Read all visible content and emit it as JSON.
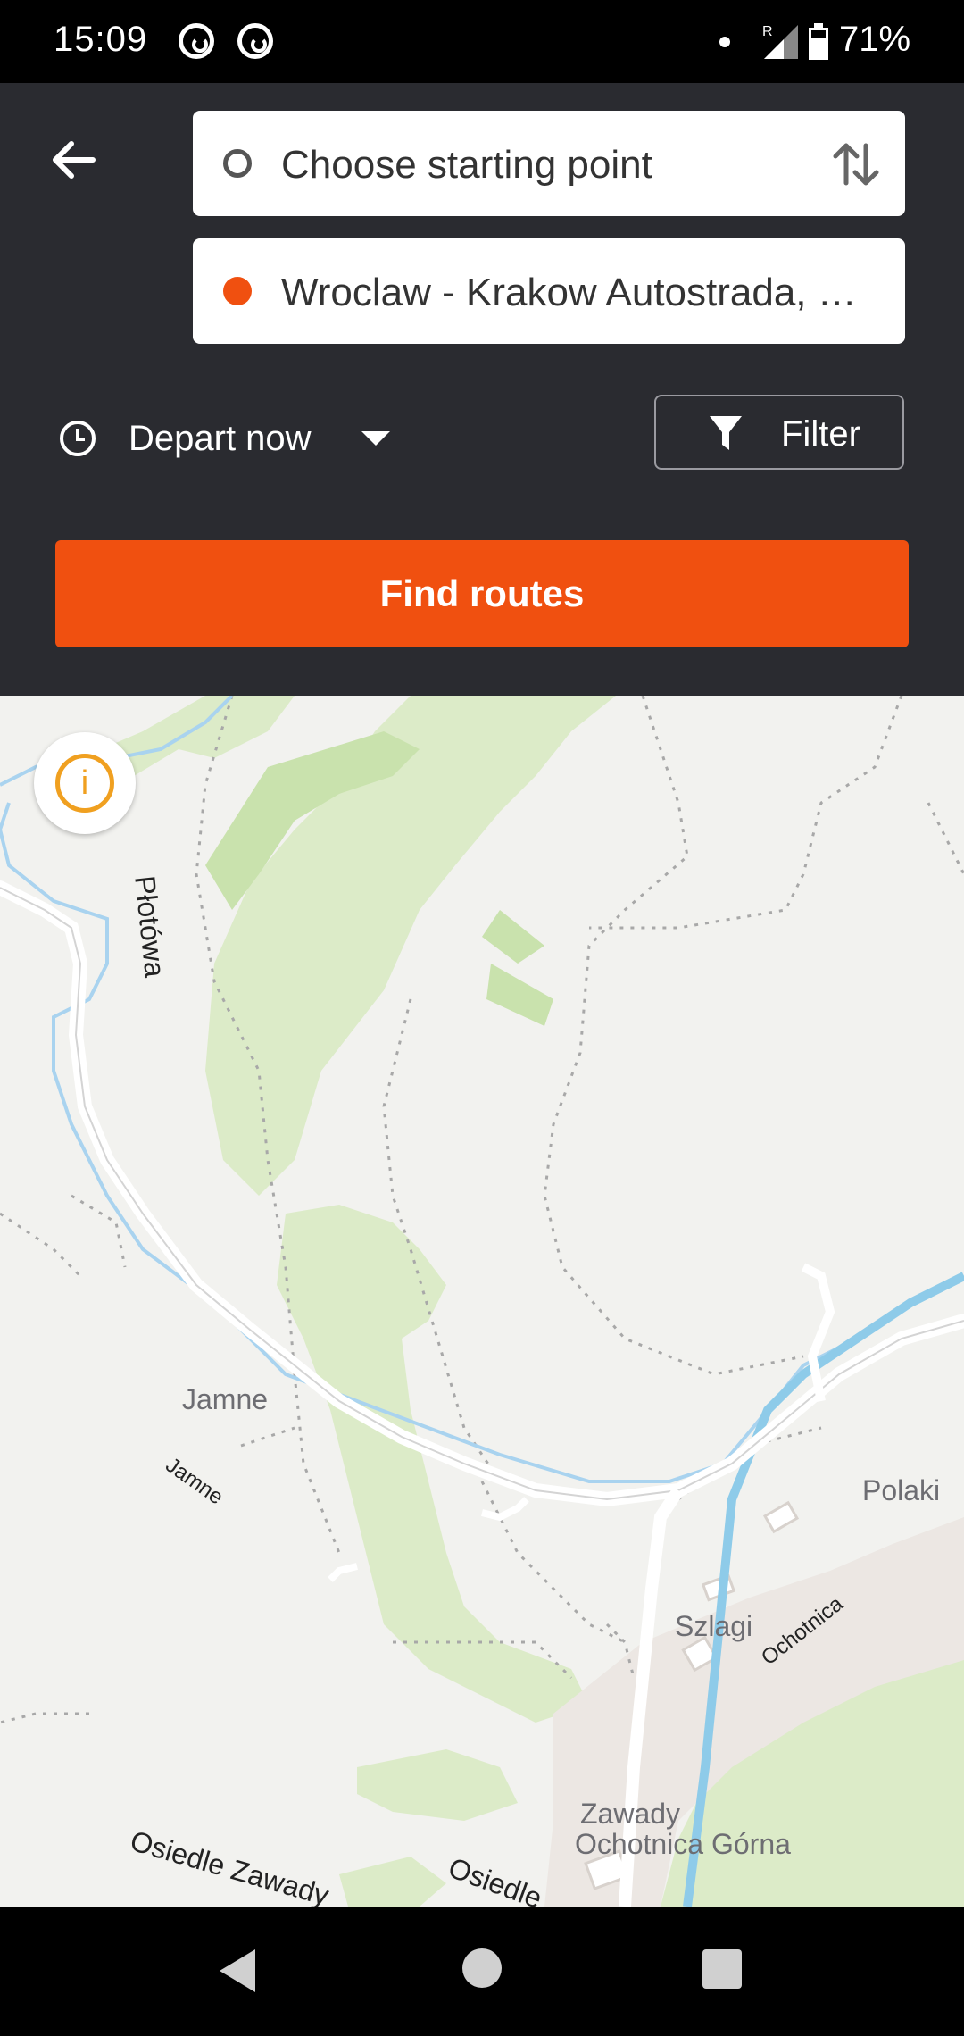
{
  "status_bar": {
    "time": "15:09",
    "roaming_indicator": "R",
    "battery_percent": "71%"
  },
  "route_planner": {
    "start_placeholder": "Choose starting point",
    "destination_value": "Wroclaw - Krakow Autostrada, R...",
    "depart_label": "Depart now",
    "filter_label": "Filter",
    "find_routes_label": "Find routes",
    "accent_color": "#f05010"
  },
  "map": {
    "labels": {
      "plotowa": "Płotówa",
      "jamne_place": "Jamne",
      "jamne_road": "Jamne",
      "polaki": "Polaki",
      "szlagi": "Szlagi",
      "ochotnica_river": "Ochotnica",
      "zawady": "Zawady",
      "ochotnica_gorna": "Ochotnica Górna",
      "osiedle_zawady": "Osiedle Zawady",
      "osiedle": "Osiedle"
    },
    "info_symbol": "i"
  }
}
